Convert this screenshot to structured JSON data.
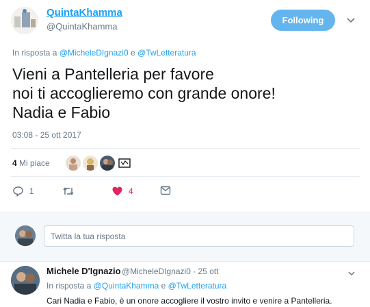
{
  "tweet": {
    "author_name": "QuintaKhamma",
    "author_handle": "@QuintaKhamma",
    "follow_label": "Following",
    "reply_prefix": "In risposta a",
    "reply_user1": "@MicheleDIgnazi0",
    "reply_and": "e",
    "reply_user2": "@TwLetteratura",
    "text": "Vieni a Pantelleria per favore\nnoi ti accoglieremo con grande onore!\nNadia e Fabio",
    "timestamp": "03:08 - 25 ott 2017",
    "likes_count": "4",
    "likes_label": "Mi piace"
  },
  "actions": {
    "reply_count": "1",
    "retweet_count": "",
    "like_count": "4"
  },
  "reply_box": {
    "placeholder": "Twitta la tua risposta"
  },
  "reply": {
    "name": "Michele D'Ignazio",
    "meta": "@MicheleDIgnazi0 · 25 ott",
    "reply_prefix": "In risposta a",
    "reply_user1": "@QuintaKhamma",
    "reply_and": "e",
    "reply_user2": "@TwLetteratura",
    "text": "Cari Nadia e Fabio, è un onore accogliere il vostro invito e venire a Pantelleria."
  },
  "colors": {
    "accent": "#1da1f2",
    "like": "#e0245e",
    "follow_bg": "#64b5ee"
  },
  "icons": [
    "avatar",
    "chevron-down-icon",
    "reply-icon",
    "retweet-icon",
    "heart-icon",
    "message-icon"
  ]
}
